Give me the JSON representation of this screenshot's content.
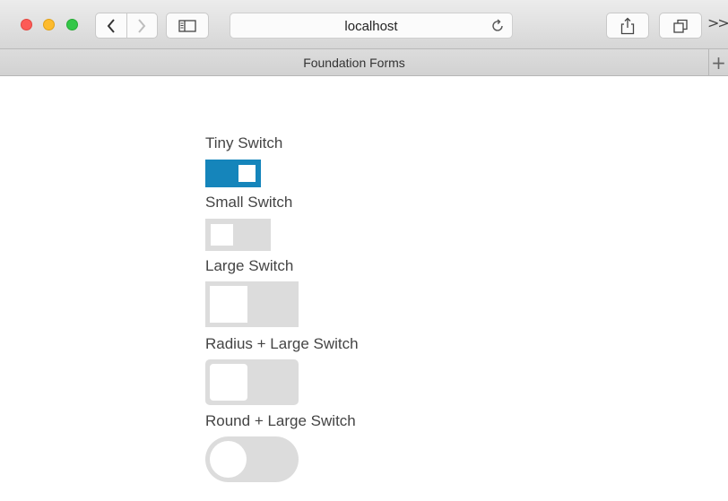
{
  "browser": {
    "address": "localhost",
    "tab_title": "Foundation Forms",
    "more_label": ">>",
    "new_tab_label": "+"
  },
  "switches": [
    {
      "label": "Tiny Switch",
      "checked": true
    },
    {
      "label": "Small Switch",
      "checked": false
    },
    {
      "label": "Large Switch",
      "checked": false
    },
    {
      "label": "Radius + Large Switch",
      "checked": false
    },
    {
      "label": "Round + Large Switch",
      "checked": false
    }
  ],
  "colors": {
    "switch_on": "#1585bb",
    "switch_off": "#dcdcdc"
  }
}
